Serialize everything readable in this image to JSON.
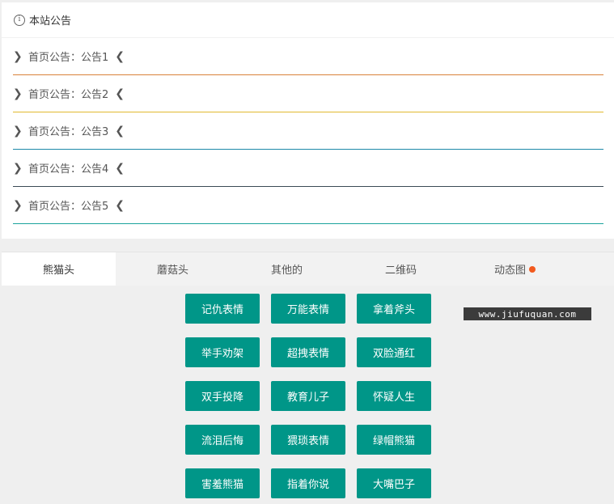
{
  "notice": {
    "title": "本站公告",
    "items": [
      {
        "text": "首页公告：公告1",
        "line_color": "#d9823b"
      },
      {
        "text": "首页公告：公告2",
        "line_color": "#e0b92e"
      },
      {
        "text": "首页公告：公告3",
        "line_color": "#1e8aa8"
      },
      {
        "text": "首页公告：公告4",
        "line_color": "#3a4a56"
      },
      {
        "text": "首页公告：公告5",
        "line_color": "#1ba39c"
      }
    ]
  },
  "tabs": [
    {
      "label": "熊猫头",
      "active": true
    },
    {
      "label": "蘑菇头",
      "active": false
    },
    {
      "label": "其他的",
      "active": false
    },
    {
      "label": "二维码",
      "active": false
    },
    {
      "label": "动态图",
      "active": false,
      "badge_dot": true
    }
  ],
  "buttons": [
    "记仇表情",
    "万能表情",
    "拿着斧头",
    "举手劝架",
    "超拽表情",
    "双脸通红",
    "双手投降",
    "教育儿子",
    "怀疑人生",
    "流泪后悔",
    "猥琐表情",
    "绿帽熊猫",
    "害羞熊猫",
    "指着你说",
    "大嘴巴子"
  ],
  "watermark": "www.jiufuquan.com",
  "colors": {
    "accent": "#009688",
    "badge": "#f25a1e"
  }
}
